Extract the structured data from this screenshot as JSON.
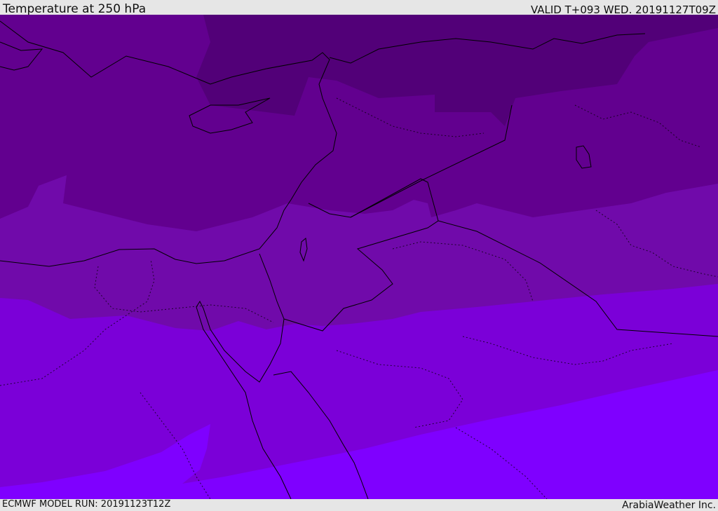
{
  "header": {
    "title": "Temperature at 250 hPa",
    "valid": "VALID T+093 WED. 20191127T09Z"
  },
  "footer": {
    "model_run": "ECMWF MODEL RUN: 20191123T12Z",
    "credit": "ArabiaWeather Inc."
  },
  "colors": {
    "band_1": "#520078",
    "band_2": "#62008f",
    "band_3": "#700aaa",
    "band_4": "#7b00d8",
    "band_5": "#7f00ff",
    "coastline": "#000000",
    "bar_background": "#e6e6e6"
  }
}
